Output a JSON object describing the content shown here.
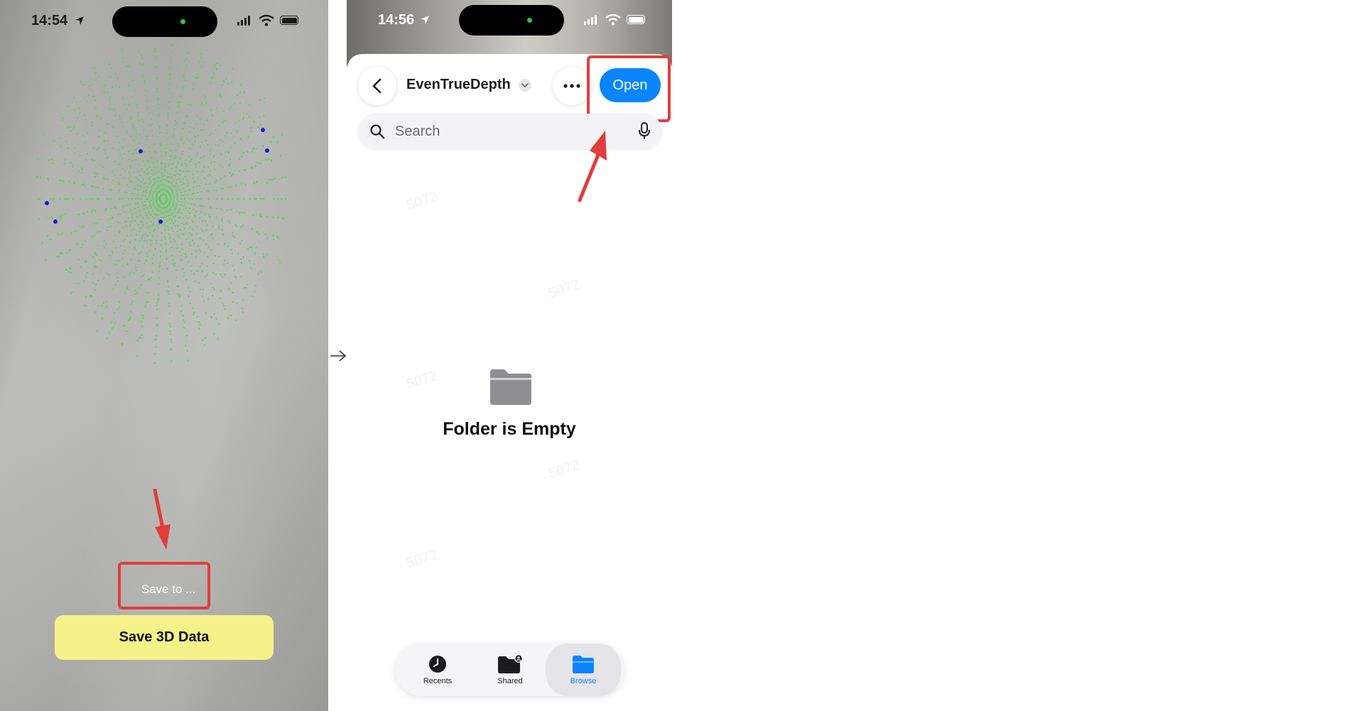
{
  "left_screen": {
    "status": {
      "time": "14:54"
    },
    "save_to_label": "Save to ...",
    "save_button_label": "Save 3D Data"
  },
  "right_screen": {
    "status": {
      "time": "14:56"
    },
    "folder_title": "EvenTrueDepth",
    "open_label": "Open",
    "search_placeholder": "Search",
    "empty_label": "Folder is Empty",
    "tabs": [
      {
        "label": "Recents"
      },
      {
        "label": "Shared"
      },
      {
        "label": "Browse",
        "selected": true
      }
    ]
  },
  "colors": {
    "accent_blue": "#0a84ff",
    "highlight_red": "#e23c3c",
    "save_button_yellow": "#f6f28a",
    "mesh_green": "#39e339",
    "landmark_blue": "#1a1acc"
  },
  "icons": [
    "location-arrow-icon",
    "signal-icon",
    "wifi-icon",
    "battery-icon",
    "back-chevron-icon",
    "chevron-down-icon",
    "more-icon",
    "search-icon",
    "mic-icon",
    "folder-icon",
    "clock-icon",
    "shared-folder-icon",
    "browse-folder-icon",
    "arrow-right-icon"
  ]
}
